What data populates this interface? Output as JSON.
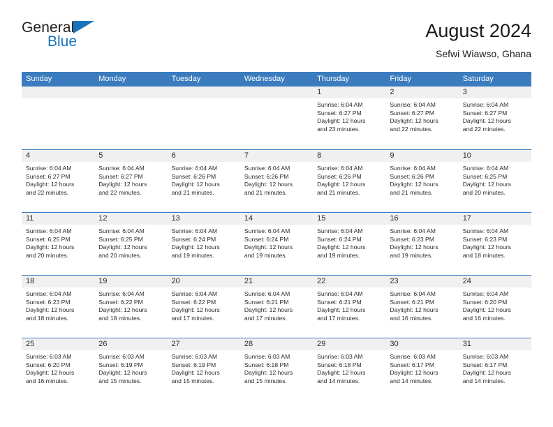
{
  "brand": {
    "name_top": "General",
    "name_bottom": "Blue",
    "accent_color": "#1a74bb"
  },
  "header": {
    "title": "August 2024",
    "subtitle": "Sefwi Wiawso, Ghana"
  },
  "theme": {
    "header_band": "#3a7cbe",
    "day_strip": "#f0f0f0",
    "text": "#2b2b2b"
  },
  "weekdays": [
    "Sunday",
    "Monday",
    "Tuesday",
    "Wednesday",
    "Thursday",
    "Friday",
    "Saturday"
  ],
  "labels": {
    "sunrise": "Sunrise:",
    "sunset": "Sunset:",
    "daylight": "Daylight:"
  },
  "weeks": [
    [
      {
        "date": "",
        "empty": true
      },
      {
        "date": "",
        "empty": true
      },
      {
        "date": "",
        "empty": true
      },
      {
        "date": "",
        "empty": true
      },
      {
        "date": "1",
        "sunrise": "Sunrise: 6:04 AM",
        "sunset": "Sunset: 6:27 PM",
        "daylight_l1": "Daylight: 12 hours",
        "daylight_l2": "and 23 minutes."
      },
      {
        "date": "2",
        "sunrise": "Sunrise: 6:04 AM",
        "sunset": "Sunset: 6:27 PM",
        "daylight_l1": "Daylight: 12 hours",
        "daylight_l2": "and 22 minutes."
      },
      {
        "date": "3",
        "sunrise": "Sunrise: 6:04 AM",
        "sunset": "Sunset: 6:27 PM",
        "daylight_l1": "Daylight: 12 hours",
        "daylight_l2": "and 22 minutes."
      }
    ],
    [
      {
        "date": "4",
        "sunrise": "Sunrise: 6:04 AM",
        "sunset": "Sunset: 6:27 PM",
        "daylight_l1": "Daylight: 12 hours",
        "daylight_l2": "and 22 minutes."
      },
      {
        "date": "5",
        "sunrise": "Sunrise: 6:04 AM",
        "sunset": "Sunset: 6:27 PM",
        "daylight_l1": "Daylight: 12 hours",
        "daylight_l2": "and 22 minutes."
      },
      {
        "date": "6",
        "sunrise": "Sunrise: 6:04 AM",
        "sunset": "Sunset: 6:26 PM",
        "daylight_l1": "Daylight: 12 hours",
        "daylight_l2": "and 21 minutes."
      },
      {
        "date": "7",
        "sunrise": "Sunrise: 6:04 AM",
        "sunset": "Sunset: 6:26 PM",
        "daylight_l1": "Daylight: 12 hours",
        "daylight_l2": "and 21 minutes."
      },
      {
        "date": "8",
        "sunrise": "Sunrise: 6:04 AM",
        "sunset": "Sunset: 6:26 PM",
        "daylight_l1": "Daylight: 12 hours",
        "daylight_l2": "and 21 minutes."
      },
      {
        "date": "9",
        "sunrise": "Sunrise: 6:04 AM",
        "sunset": "Sunset: 6:26 PM",
        "daylight_l1": "Daylight: 12 hours",
        "daylight_l2": "and 21 minutes."
      },
      {
        "date": "10",
        "sunrise": "Sunrise: 6:04 AM",
        "sunset": "Sunset: 6:25 PM",
        "daylight_l1": "Daylight: 12 hours",
        "daylight_l2": "and 20 minutes."
      }
    ],
    [
      {
        "date": "11",
        "sunrise": "Sunrise: 6:04 AM",
        "sunset": "Sunset: 6:25 PM",
        "daylight_l1": "Daylight: 12 hours",
        "daylight_l2": "and 20 minutes."
      },
      {
        "date": "12",
        "sunrise": "Sunrise: 6:04 AM",
        "sunset": "Sunset: 6:25 PM",
        "daylight_l1": "Daylight: 12 hours",
        "daylight_l2": "and 20 minutes."
      },
      {
        "date": "13",
        "sunrise": "Sunrise: 6:04 AM",
        "sunset": "Sunset: 6:24 PM",
        "daylight_l1": "Daylight: 12 hours",
        "daylight_l2": "and 19 minutes."
      },
      {
        "date": "14",
        "sunrise": "Sunrise: 6:04 AM",
        "sunset": "Sunset: 6:24 PM",
        "daylight_l1": "Daylight: 12 hours",
        "daylight_l2": "and 19 minutes."
      },
      {
        "date": "15",
        "sunrise": "Sunrise: 6:04 AM",
        "sunset": "Sunset: 6:24 PM",
        "daylight_l1": "Daylight: 12 hours",
        "daylight_l2": "and 19 minutes."
      },
      {
        "date": "16",
        "sunrise": "Sunrise: 6:04 AM",
        "sunset": "Sunset: 6:23 PM",
        "daylight_l1": "Daylight: 12 hours",
        "daylight_l2": "and 19 minutes."
      },
      {
        "date": "17",
        "sunrise": "Sunrise: 6:04 AM",
        "sunset": "Sunset: 6:23 PM",
        "daylight_l1": "Daylight: 12 hours",
        "daylight_l2": "and 18 minutes."
      }
    ],
    [
      {
        "date": "18",
        "sunrise": "Sunrise: 6:04 AM",
        "sunset": "Sunset: 6:23 PM",
        "daylight_l1": "Daylight: 12 hours",
        "daylight_l2": "and 18 minutes."
      },
      {
        "date": "19",
        "sunrise": "Sunrise: 6:04 AM",
        "sunset": "Sunset: 6:22 PM",
        "daylight_l1": "Daylight: 12 hours",
        "daylight_l2": "and 18 minutes."
      },
      {
        "date": "20",
        "sunrise": "Sunrise: 6:04 AM",
        "sunset": "Sunset: 6:22 PM",
        "daylight_l1": "Daylight: 12 hours",
        "daylight_l2": "and 17 minutes."
      },
      {
        "date": "21",
        "sunrise": "Sunrise: 6:04 AM",
        "sunset": "Sunset: 6:21 PM",
        "daylight_l1": "Daylight: 12 hours",
        "daylight_l2": "and 17 minutes."
      },
      {
        "date": "22",
        "sunrise": "Sunrise: 6:04 AM",
        "sunset": "Sunset: 6:21 PM",
        "daylight_l1": "Daylight: 12 hours",
        "daylight_l2": "and 17 minutes."
      },
      {
        "date": "23",
        "sunrise": "Sunrise: 6:04 AM",
        "sunset": "Sunset: 6:21 PM",
        "daylight_l1": "Daylight: 12 hours",
        "daylight_l2": "and 16 minutes."
      },
      {
        "date": "24",
        "sunrise": "Sunrise: 6:04 AM",
        "sunset": "Sunset: 6:20 PM",
        "daylight_l1": "Daylight: 12 hours",
        "daylight_l2": "and 16 minutes."
      }
    ],
    [
      {
        "date": "25",
        "sunrise": "Sunrise: 6:03 AM",
        "sunset": "Sunset: 6:20 PM",
        "daylight_l1": "Daylight: 12 hours",
        "daylight_l2": "and 16 minutes."
      },
      {
        "date": "26",
        "sunrise": "Sunrise: 6:03 AM",
        "sunset": "Sunset: 6:19 PM",
        "daylight_l1": "Daylight: 12 hours",
        "daylight_l2": "and 15 minutes."
      },
      {
        "date": "27",
        "sunrise": "Sunrise: 6:03 AM",
        "sunset": "Sunset: 6:19 PM",
        "daylight_l1": "Daylight: 12 hours",
        "daylight_l2": "and 15 minutes."
      },
      {
        "date": "28",
        "sunrise": "Sunrise: 6:03 AM",
        "sunset": "Sunset: 6:18 PM",
        "daylight_l1": "Daylight: 12 hours",
        "daylight_l2": "and 15 minutes."
      },
      {
        "date": "29",
        "sunrise": "Sunrise: 6:03 AM",
        "sunset": "Sunset: 6:18 PM",
        "daylight_l1": "Daylight: 12 hours",
        "daylight_l2": "and 14 minutes."
      },
      {
        "date": "30",
        "sunrise": "Sunrise: 6:03 AM",
        "sunset": "Sunset: 6:17 PM",
        "daylight_l1": "Daylight: 12 hours",
        "daylight_l2": "and 14 minutes."
      },
      {
        "date": "31",
        "sunrise": "Sunrise: 6:03 AM",
        "sunset": "Sunset: 6:17 PM",
        "daylight_l1": "Daylight: 12 hours",
        "daylight_l2": "and 14 minutes."
      }
    ]
  ]
}
